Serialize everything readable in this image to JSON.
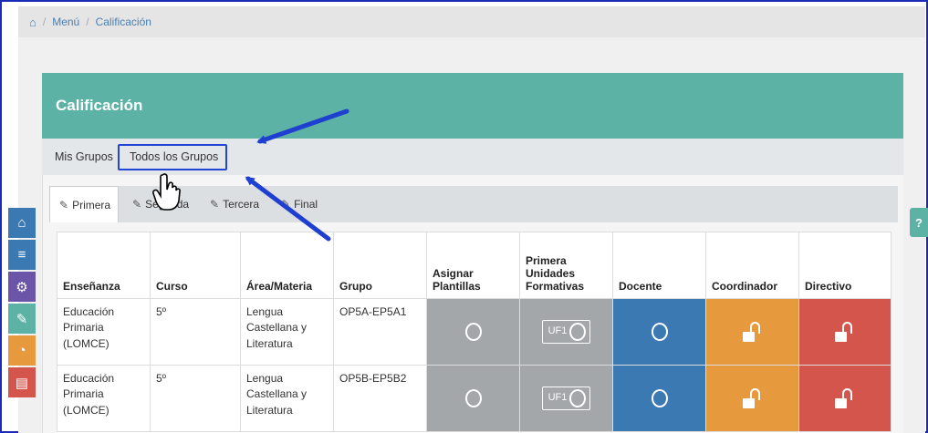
{
  "breadcrumb": {
    "home": "⌂",
    "menu": "Menú",
    "current": "Calificación"
  },
  "panel": {
    "title": "Calificación"
  },
  "group_tabs": {
    "mine": "Mis Grupos",
    "all": "Todos los Grupos"
  },
  "period_tabs": [
    "Primera",
    "Segunda",
    "Tercera",
    "Final"
  ],
  "table": {
    "headers": [
      "Enseñanza",
      "Curso",
      "Área/Materia",
      "Grupo",
      "Asignar Plantillas",
      "Primera Unidades Formativas",
      "Docente",
      "Coordinador",
      "Directivo"
    ],
    "rows": [
      {
        "ensenanza": "Educación Primaria (LOMCE)",
        "curso": "5º",
        "area": "Lengua Castellana y Literatura",
        "grupo": "OP5A-EP5A1"
      },
      {
        "ensenanza": "Educación Primaria (LOMCE)",
        "curso": "5º",
        "area": "Lengua Castellana y Literatura",
        "grupo": "OP5B-EP5B2"
      }
    ],
    "uf_label": "UF1"
  },
  "colors": {
    "header_teal": "#5cb2a5",
    "grey": "#a4a7aa",
    "blue": "#3b79b3",
    "orange": "#e79a3d",
    "red": "#d3554b",
    "annotation_blue": "#1f3fd0"
  },
  "sidebar_icons": [
    "home-icon",
    "list-icon",
    "gears-icon",
    "edit-icon",
    "pie-chart-icon",
    "document-icon"
  ],
  "help_label": "?"
}
